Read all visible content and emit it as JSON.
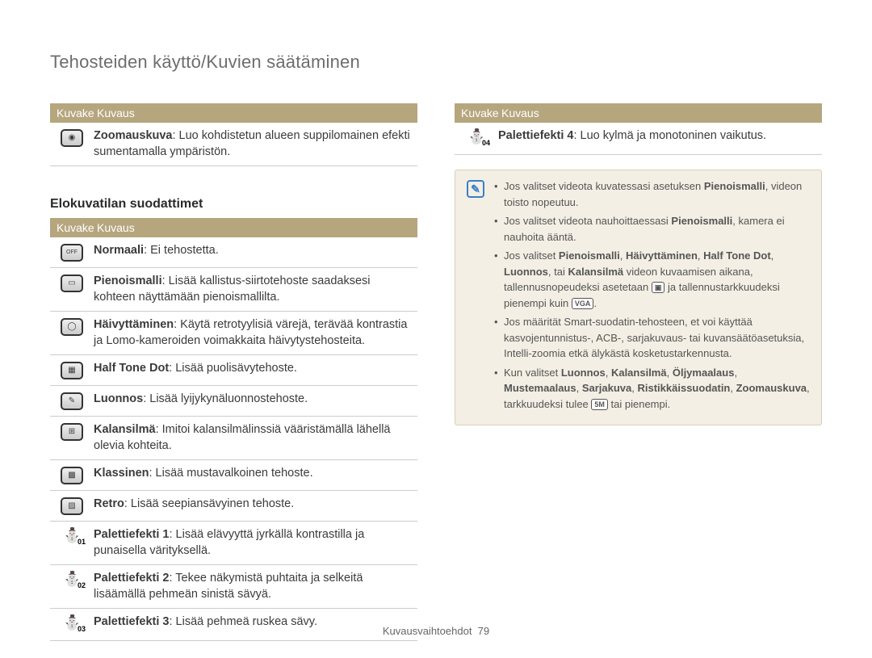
{
  "page_title": "Tehosteiden käyttö/Kuvien säätäminen",
  "header": {
    "icon": "Kuvake",
    "desc": "Kuvaus"
  },
  "left_table_1": [
    {
      "bold": "Zoomauskuva",
      "rest": ": Luo kohdistetun alueen suppilomainen efekti sumentamalla ympäristön."
    }
  ],
  "section_title": "Elokuvatilan suodattimet",
  "left_table_2": [
    {
      "bold": "Normaali",
      "rest": ": Ei tehostetta."
    },
    {
      "bold": "Pienoismalli",
      "rest": ": Lisää kallistus-siirtotehoste saadaksesi kohteen näyttämään pienoismallilta."
    },
    {
      "bold": "Häivyttäminen",
      "rest": ": Käytä retrotyylisiä värejä, terävää kontrastia ja Lomo-kameroiden voimakkaita häivytystehosteita."
    },
    {
      "bold": "Half Tone Dot",
      "rest": ": Lisää puolisävytehoste."
    },
    {
      "bold": "Luonnos",
      "rest": ": Lisää lyijykynäluonnostehoste."
    },
    {
      "bold": "Kalansilmä",
      "rest": ": Imitoi kalansilmälinssiä vääristämällä lähellä olevia kohteita."
    },
    {
      "bold": "Klassinen",
      "rest": ": Lisää mustavalkoinen tehoste."
    },
    {
      "bold": "Retro",
      "rest": ": Lisää seepiansävyinen tehoste."
    },
    {
      "bold": "Palettiefekti 1",
      "rest": ": Lisää elävyyttä jyrkällä kontrastilla ja punaisella värityksellä."
    },
    {
      "bold": "Palettiefekti 2",
      "rest": ": Tekee näkymistä puhtaita ja selkeitä lisäämällä pehmeän sinistä sävyä."
    },
    {
      "bold": "Palettiefekti 3",
      "rest": ": Lisää pehmeä ruskea sävy."
    }
  ],
  "right_table": [
    {
      "bold": "Palettiefekti 4",
      "rest": ": Luo kylmä ja monotoninen vaikutus."
    }
  ],
  "notes": [
    {
      "pre": "Jos valitset videota kuvatessasi asetuksen ",
      "b1": "Pienoismalli",
      "post": ", videon toisto nopeutuu."
    },
    {
      "pre": "Jos valitset videota nauhoittaessasi ",
      "b1": "Pienoismalli",
      "post": ", kamera ei nauhoita ääntä."
    },
    {
      "multi": true,
      "parts": [
        "Jos valitset ",
        "Pienoismalli",
        ", ",
        "Häivyttäminen",
        ", ",
        "Half Tone Dot",
        ", ",
        "Luonnos",
        ", tai ",
        "Kalansilmä",
        " videon kuvaamisen aikana, tallennusnopeudeksi asetetaan "
      ],
      "icon1": "▣",
      "mid": " ja tallennustarkkuudeksi pienempi kuin ",
      "icon2": "VGA",
      "end": "."
    },
    {
      "plain": "Jos määrität Smart-suodatin-tehosteen, et voi käyttää kasvojentunnistus-, ACB-, sarjakuvaus- tai kuvansäätöasetuksia, Intelli-zoomia etkä älykästä kosketustarkennusta."
    },
    {
      "multi": true,
      "parts": [
        "Kun valitset ",
        "Luonnos",
        ", ",
        "Kalansilmä",
        ", ",
        "Öljymaalaus",
        ", ",
        "Mustemaalaus",
        ", ",
        "Sarjakuva",
        ", ",
        "Ristikkäissuodatin",
        ", ",
        "Zoomauskuva",
        ", tarkkuudeksi tulee "
      ],
      "icon1": "5M",
      "end": " tai pienempi."
    }
  ],
  "footer": {
    "label": "Kuvausvaihtoehdot",
    "page": "79"
  }
}
